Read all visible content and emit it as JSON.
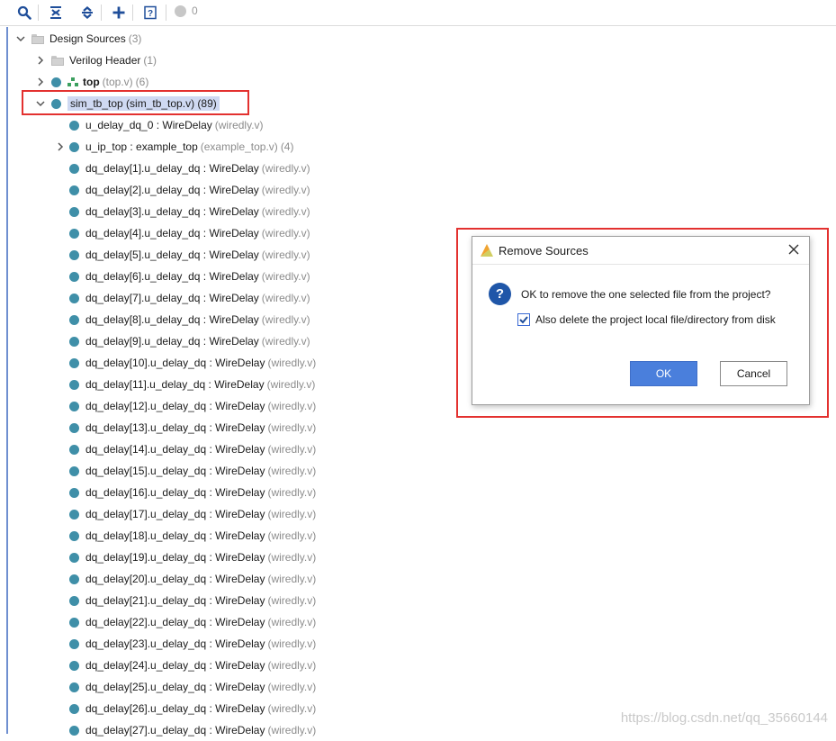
{
  "toolbar": {
    "items": [
      "search-icon",
      "collapse-all-icon",
      "expand-all-icon",
      "add-icon",
      "help-icon"
    ],
    "count": "0"
  },
  "tree": {
    "design_sources": {
      "label": "Design Sources",
      "count": "(3)"
    },
    "verilog_header": {
      "label": "Verilog Header",
      "count": "(1)"
    },
    "top": {
      "label": "top",
      "file": "(top.v)",
      "count": "(6)"
    },
    "sim_tb_top": {
      "label": "sim_tb_top (sim_tb_top.v) (89)"
    },
    "u_delay_dq_0": {
      "label": "u_delay_dq_0 : WireDelay",
      "file": "(wiredly.v)"
    },
    "u_ip_top": {
      "label": "u_ip_top : example_top",
      "file": "(example_top.v)",
      "count": "(4)"
    },
    "dq_items": [
      {
        "label": "dq_delay[1].u_delay_dq : WireDelay",
        "file": "(wiredly.v)"
      },
      {
        "label": "dq_delay[2].u_delay_dq : WireDelay",
        "file": "(wiredly.v)"
      },
      {
        "label": "dq_delay[3].u_delay_dq : WireDelay",
        "file": "(wiredly.v)"
      },
      {
        "label": "dq_delay[4].u_delay_dq : WireDelay",
        "file": "(wiredly.v)"
      },
      {
        "label": "dq_delay[5].u_delay_dq : WireDelay",
        "file": "(wiredly.v)"
      },
      {
        "label": "dq_delay[6].u_delay_dq : WireDelay",
        "file": "(wiredly.v)"
      },
      {
        "label": "dq_delay[7].u_delay_dq : WireDelay",
        "file": "(wiredly.v)"
      },
      {
        "label": "dq_delay[8].u_delay_dq : WireDelay",
        "file": "(wiredly.v)"
      },
      {
        "label": "dq_delay[9].u_delay_dq : WireDelay",
        "file": "(wiredly.v)"
      },
      {
        "label": "dq_delay[10].u_delay_dq : WireDelay",
        "file": "(wiredly.v)"
      },
      {
        "label": "dq_delay[11].u_delay_dq : WireDelay",
        "file": "(wiredly.v)"
      },
      {
        "label": "dq_delay[12].u_delay_dq : WireDelay",
        "file": "(wiredly.v)"
      },
      {
        "label": "dq_delay[13].u_delay_dq : WireDelay",
        "file": "(wiredly.v)"
      },
      {
        "label": "dq_delay[14].u_delay_dq : WireDelay",
        "file": "(wiredly.v)"
      },
      {
        "label": "dq_delay[15].u_delay_dq : WireDelay",
        "file": "(wiredly.v)"
      },
      {
        "label": "dq_delay[16].u_delay_dq : WireDelay",
        "file": "(wiredly.v)"
      },
      {
        "label": "dq_delay[17].u_delay_dq : WireDelay",
        "file": "(wiredly.v)"
      },
      {
        "label": "dq_delay[18].u_delay_dq : WireDelay",
        "file": "(wiredly.v)"
      },
      {
        "label": "dq_delay[19].u_delay_dq : WireDelay",
        "file": "(wiredly.v)"
      },
      {
        "label": "dq_delay[20].u_delay_dq : WireDelay",
        "file": "(wiredly.v)"
      },
      {
        "label": "dq_delay[21].u_delay_dq : WireDelay",
        "file": "(wiredly.v)"
      },
      {
        "label": "dq_delay[22].u_delay_dq : WireDelay",
        "file": "(wiredly.v)"
      },
      {
        "label": "dq_delay[23].u_delay_dq : WireDelay",
        "file": "(wiredly.v)"
      },
      {
        "label": "dq_delay[24].u_delay_dq : WireDelay",
        "file": "(wiredly.v)"
      },
      {
        "label": "dq_delay[25].u_delay_dq : WireDelay",
        "file": "(wiredly.v)"
      },
      {
        "label": "dq_delay[26].u_delay_dq : WireDelay",
        "file": "(wiredly.v)"
      },
      {
        "label": "dq_delay[27].u_delay_dq : WireDelay",
        "file": "(wiredly.v)"
      }
    ]
  },
  "dialog": {
    "title": "Remove Sources",
    "message": "OK to remove the one selected file from the project?",
    "checkbox_label": "Also delete the project local file/directory from disk",
    "checkbox_checked": true,
    "ok_label": "OK",
    "cancel_label": "Cancel"
  },
  "colors": {
    "highlight": "#e3312f",
    "ok_button": "#4a7fdc",
    "module_dot": "#3f8fa8"
  },
  "watermark": "https://blog.csdn.net/qq_35660144"
}
